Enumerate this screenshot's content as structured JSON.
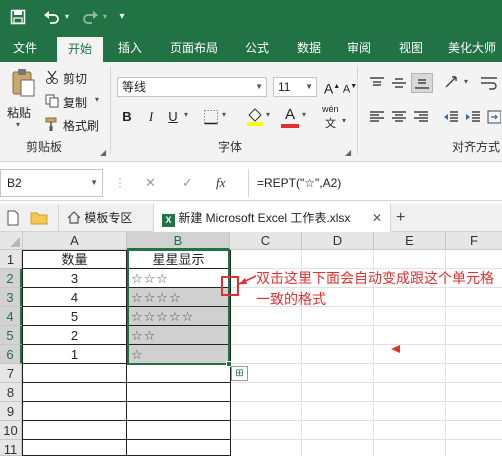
{
  "quick_access": {
    "save_icon": "save-icon",
    "undo_icon": "undo-icon",
    "redo_icon": "redo-icon",
    "customize_icon": "customize-qat-icon"
  },
  "ribbon_tabs": [
    "文件",
    "开始",
    "插入",
    "页面布局",
    "公式",
    "数据",
    "审阅",
    "视图",
    "美化大师"
  ],
  "active_tab": "开始",
  "clipboard": {
    "paste": "粘贴",
    "cut": "剪切",
    "copy": "复制",
    "format_painter": "格式刷",
    "group_label": "剪贴板"
  },
  "font": {
    "name": "等线",
    "size": "11",
    "bold": "B",
    "italic": "I",
    "underline": "U",
    "grow": "A",
    "shrink": "A",
    "font_color": "A",
    "phonetic": "wén",
    "group_label": "字体"
  },
  "alignment": {
    "group_label": "对齐方式"
  },
  "formula_bar": {
    "name_box": "B2",
    "cancel": "✕",
    "enter": "✓",
    "fx": "fx",
    "formula": "=REPT(\"☆\",A2)"
  },
  "workbook_tabs": [
    {
      "label": "模板专区"
    },
    {
      "label": "新建 Microsoft Excel 工作表.xlsx"
    }
  ],
  "new_tab": "+",
  "grid": {
    "columns": [
      "A",
      "B",
      "C",
      "D",
      "E",
      "F"
    ],
    "selected_column": "B",
    "rows": [
      "1",
      "2",
      "3",
      "4",
      "5",
      "6",
      "7",
      "8",
      "9",
      "10",
      "11"
    ],
    "header": {
      "a": "数量",
      "b": "星星显示"
    },
    "data": [
      {
        "a": "3",
        "b": "☆☆☆"
      },
      {
        "a": "4",
        "b": "☆☆☆☆"
      },
      {
        "a": "5",
        "b": "☆☆☆☆☆"
      },
      {
        "a": "2",
        "b": "☆☆"
      },
      {
        "a": "1",
        "b": "☆"
      }
    ]
  },
  "annotation": "双击这里下面会自动变成跟这个单元格一致的格式",
  "colors": {
    "excel_green": "#217346",
    "annotation_red": "#e03030",
    "selected_fill": "#d0d0d0"
  }
}
